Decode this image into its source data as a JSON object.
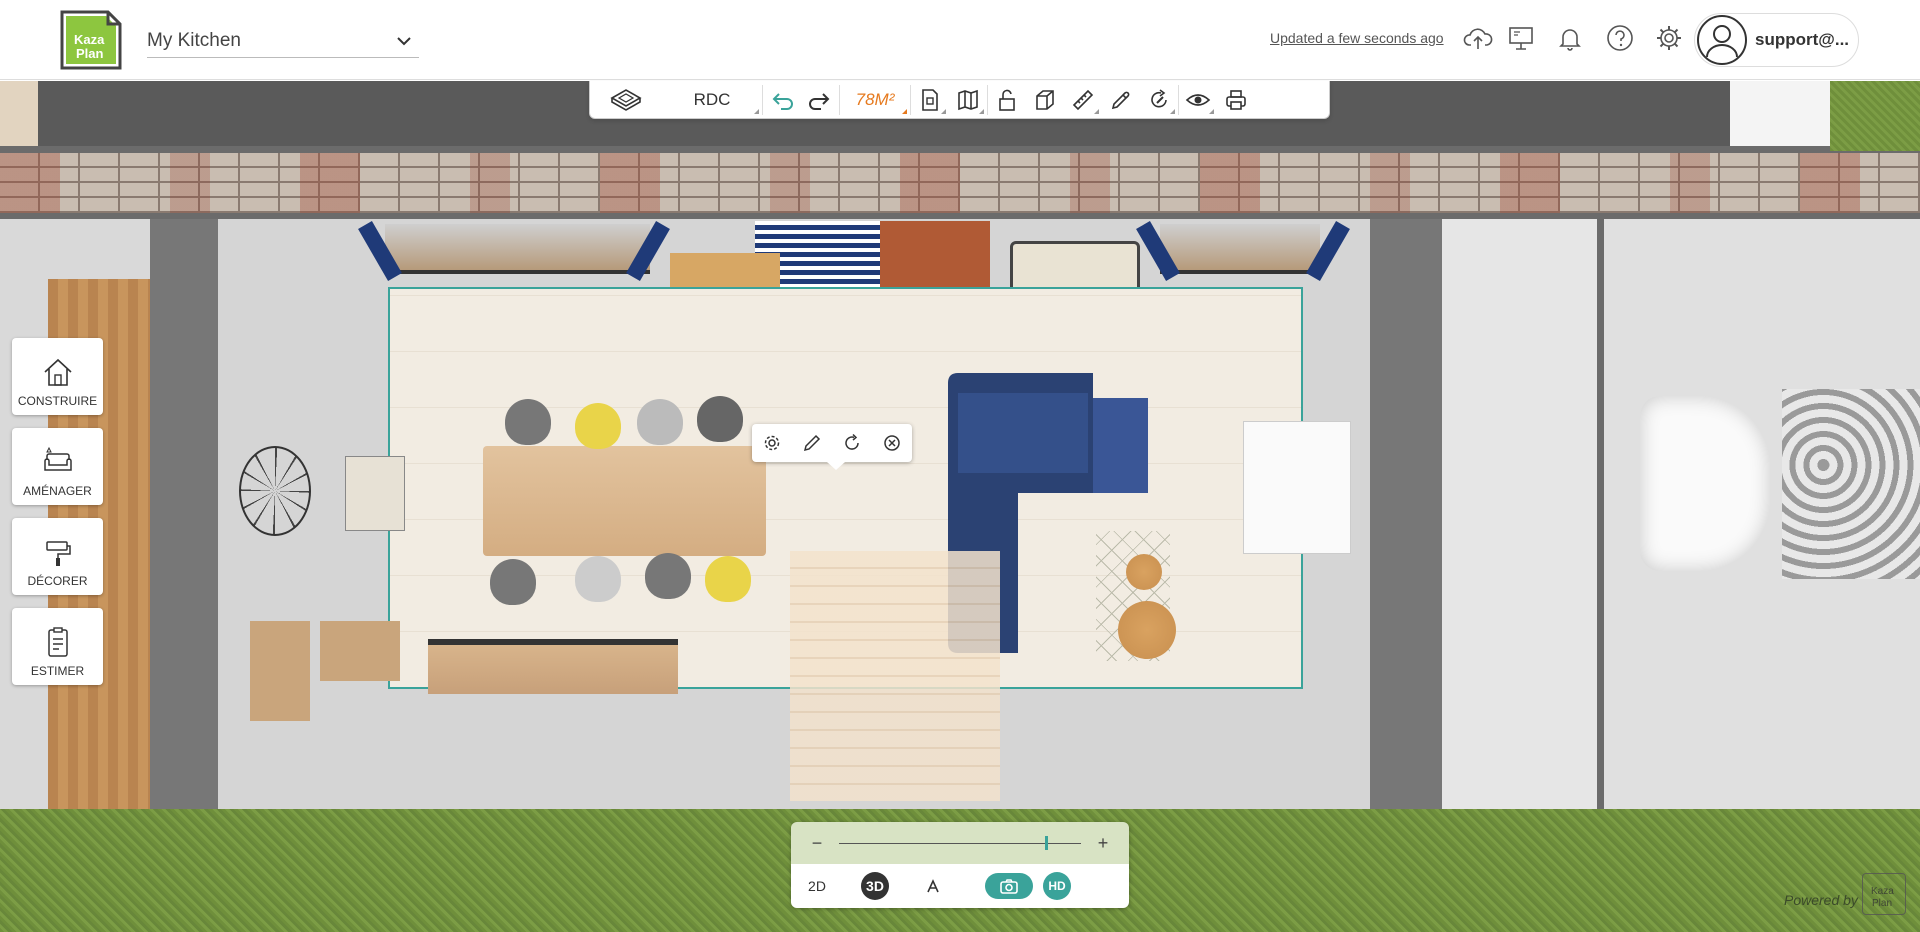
{
  "header": {
    "logo_text_top": "Kaza",
    "logo_text_bottom": "Plan",
    "project_name": "My Kitchen",
    "updated_text": "Updated a few seconds ago",
    "user_name": "support@..."
  },
  "toolbar": {
    "level": "RDC",
    "area": "78M²"
  },
  "left_nav": {
    "construire": "CONSTRUIRE",
    "amenager": "AMÉNAGER",
    "decorer": "DÉCORER",
    "estimer": "ESTIMER"
  },
  "bottom": {
    "zoom_minus": "−",
    "zoom_plus": "+",
    "zoom_level": 0.85,
    "view_2d": "2D",
    "view_3d": "3D",
    "view_walk": "⋏",
    "hd": "HD"
  },
  "footer": {
    "powered_by": "Powered by"
  },
  "colors": {
    "accent": "#3aa39a",
    "area_orange": "#e67a1f",
    "logo_green": "#8dc63f"
  }
}
